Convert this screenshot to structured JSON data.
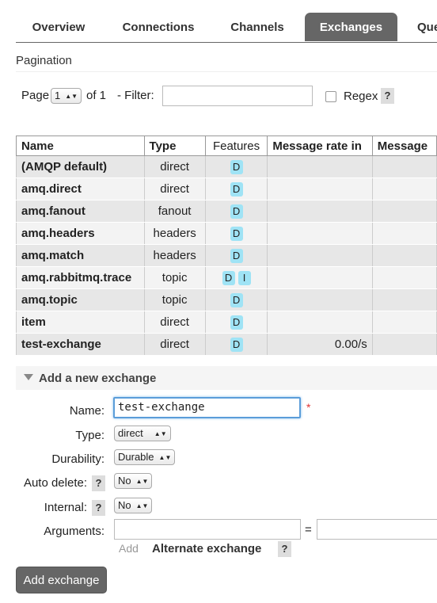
{
  "tabs": [
    "Overview",
    "Connections",
    "Channels",
    "Exchanges",
    "Que"
  ],
  "active_tab": "Exchanges",
  "pagination": {
    "section_title": "Pagination",
    "page_label": "Page",
    "page_value": "1",
    "of_text": "of 1",
    "filter_label": "- Filter:",
    "filter_value": "",
    "regex_label": "Regex",
    "help": "?"
  },
  "table": {
    "headers": [
      "Name",
      "Type",
      "Features",
      "Message rate in",
      "Message"
    ],
    "rows": [
      {
        "name": "(AMQP default)",
        "type": "direct",
        "features": [
          "D"
        ],
        "rate_in": ""
      },
      {
        "name": "amq.direct",
        "type": "direct",
        "features": [
          "D"
        ],
        "rate_in": ""
      },
      {
        "name": "amq.fanout",
        "type": "fanout",
        "features": [
          "D"
        ],
        "rate_in": ""
      },
      {
        "name": "amq.headers",
        "type": "headers",
        "features": [
          "D"
        ],
        "rate_in": ""
      },
      {
        "name": "amq.match",
        "type": "headers",
        "features": [
          "D"
        ],
        "rate_in": ""
      },
      {
        "name": "amq.rabbitmq.trace",
        "type": "topic",
        "features": [
          "D",
          "I"
        ],
        "rate_in": ""
      },
      {
        "name": "amq.topic",
        "type": "topic",
        "features": [
          "D"
        ],
        "rate_in": ""
      },
      {
        "name": "item",
        "type": "direct",
        "features": [
          "D"
        ],
        "rate_in": ""
      },
      {
        "name": "test-exchange",
        "type": "direct",
        "features": [
          "D"
        ],
        "rate_in": "0.00/s"
      }
    ]
  },
  "add_exchange": {
    "header": "Add a new exchange",
    "name_label": "Name:",
    "name_value": "test-exchange",
    "required_mark": "*",
    "type_label": "Type:",
    "type_value": "direct",
    "durability_label": "Durability:",
    "durability_value": "Durable",
    "auto_delete_label": "Auto delete:",
    "auto_delete_value": "No",
    "internal_label": "Internal:",
    "internal_value": "No",
    "arguments_label": "Arguments:",
    "arguments_key": "",
    "arguments_value": "",
    "equals": "=",
    "add_link": "Add",
    "alternate_exchange": "Alternate exchange",
    "help": "?",
    "submit_label": "Add exchange"
  },
  "colors": {
    "tab_active": "#666666",
    "badge": "#9fe3f5",
    "focus": "#5b9dd9",
    "required": "#e03333"
  }
}
